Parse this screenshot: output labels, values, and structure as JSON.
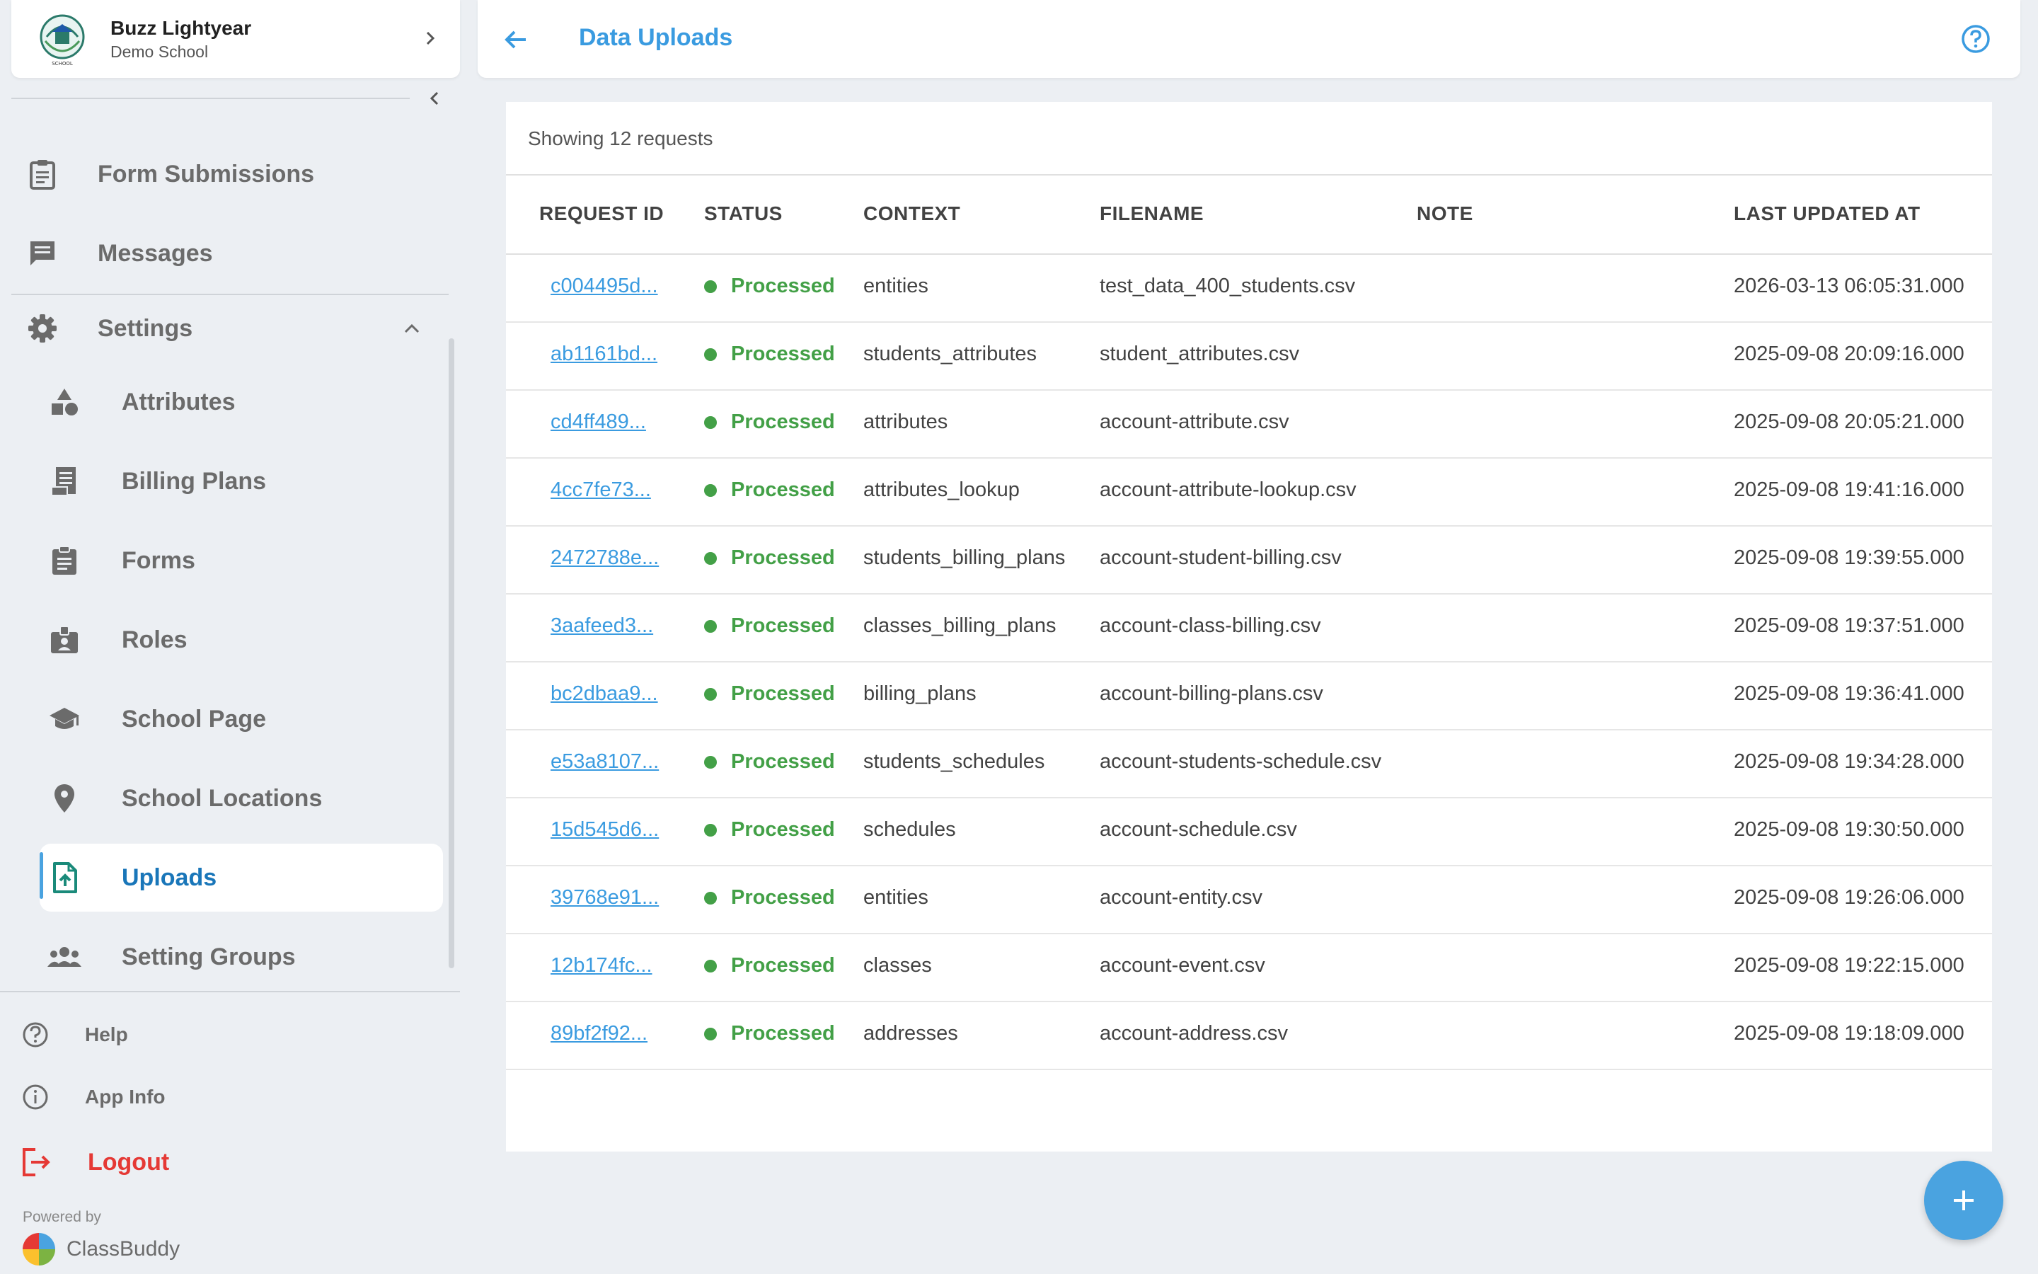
{
  "user": {
    "name": "Buzz Lightyear",
    "school": "Demo School"
  },
  "nav": {
    "form_submissions": "Form Submissions",
    "messages": "Messages",
    "settings": "Settings",
    "settings_items": [
      {
        "label": "Attributes",
        "icon": "shapes-icon"
      },
      {
        "label": "Billing Plans",
        "icon": "receipt-icon"
      },
      {
        "label": "Forms",
        "icon": "clipboard-icon"
      },
      {
        "label": "Roles",
        "icon": "id-badge-icon"
      },
      {
        "label": "School Page",
        "icon": "graduation-cap-icon"
      },
      {
        "label": "School Locations",
        "icon": "location-pin-icon"
      },
      {
        "label": "Uploads",
        "icon": "file-upload-icon"
      },
      {
        "label": "Setting Groups",
        "icon": "group-icon"
      }
    ],
    "help": "Help",
    "app_info": "App Info",
    "logout": "Logout"
  },
  "footer": {
    "powered_by": "Powered by",
    "brand": "ClassBuddy"
  },
  "header": {
    "title": "Data Uploads"
  },
  "table": {
    "summary": "Showing 12 requests",
    "columns": [
      "REQUEST ID",
      "STATUS",
      "CONTEXT",
      "FILENAME",
      "NOTE",
      "LAST UPDATED AT"
    ],
    "rows": [
      {
        "id": "c004495d...",
        "status": "Processed",
        "context": "entities",
        "filename": "test_data_400_students.csv",
        "note": "",
        "updated": "2026-03-13 06:05:31.000"
      },
      {
        "id": "ab1161bd...",
        "status": "Processed",
        "context": "students_attributes",
        "filename": "student_attributes.csv",
        "note": "",
        "updated": "2025-09-08 20:09:16.000"
      },
      {
        "id": "cd4ff489...",
        "status": "Processed",
        "context": "attributes",
        "filename": "account-attribute.csv",
        "note": "",
        "updated": "2025-09-08 20:05:21.000"
      },
      {
        "id": "4cc7fe73...",
        "status": "Processed",
        "context": "attributes_lookup",
        "filename": "account-attribute-lookup.csv",
        "note": "",
        "updated": "2025-09-08 19:41:16.000"
      },
      {
        "id": "2472788e...",
        "status": "Processed",
        "context": "students_billing_plans",
        "filename": "account-student-billing.csv",
        "note": "",
        "updated": "2025-09-08 19:39:55.000"
      },
      {
        "id": "3aafeed3...",
        "status": "Processed",
        "context": "classes_billing_plans",
        "filename": "account-class-billing.csv",
        "note": "",
        "updated": "2025-09-08 19:37:51.000"
      },
      {
        "id": "bc2dbaa9...",
        "status": "Processed",
        "context": "billing_plans",
        "filename": "account-billing-plans.csv",
        "note": "",
        "updated": "2025-09-08 19:36:41.000"
      },
      {
        "id": "e53a8107...",
        "status": "Processed",
        "context": "students_schedules",
        "filename": "account-students-schedule.csv",
        "note": "",
        "updated": "2025-09-08 19:34:28.000"
      },
      {
        "id": "15d545d6...",
        "status": "Processed",
        "context": "schedules",
        "filename": "account-schedule.csv",
        "note": "",
        "updated": "2025-09-08 19:30:50.000"
      },
      {
        "id": "39768e91...",
        "status": "Processed",
        "context": "entities",
        "filename": "account-entity.csv",
        "note": "",
        "updated": "2025-09-08 19:26:06.000"
      },
      {
        "id": "12b174fc...",
        "status": "Processed",
        "context": "classes",
        "filename": "account-event.csv",
        "note": "",
        "updated": "2025-09-08 19:22:15.000"
      },
      {
        "id": "89bf2f92...",
        "status": "Processed",
        "context": "addresses",
        "filename": "account-address.csv",
        "note": "",
        "updated": "2025-09-08 19:18:09.000"
      }
    ]
  },
  "colors": {
    "accent": "#3a9be0",
    "active_nav": "#1976b9",
    "processed": "#43a047",
    "logout": "#e53935"
  }
}
